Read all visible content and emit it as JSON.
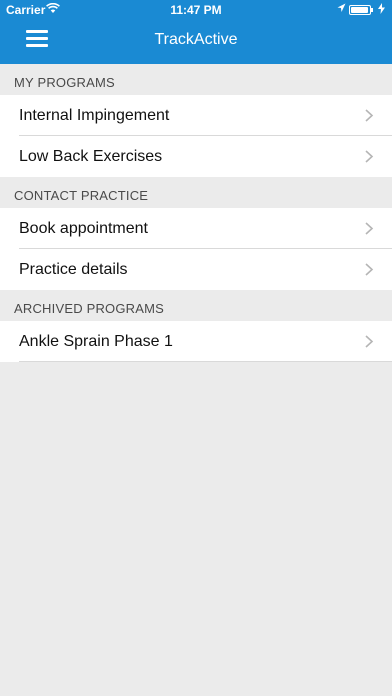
{
  "status_bar": {
    "carrier": "Carrier",
    "time": "11:47 PM"
  },
  "nav": {
    "title": "TrackActive",
    "menu_icon": "hamburger-menu-icon"
  },
  "sections": [
    {
      "header": "MY PROGRAMS",
      "items": [
        {
          "label": "Internal Impingement"
        },
        {
          "label": "Low Back Exercises"
        }
      ]
    },
    {
      "header": "CONTACT PRACTICE",
      "items": [
        {
          "label": "Book appointment"
        },
        {
          "label": "Practice details"
        }
      ]
    },
    {
      "header": "ARCHIVED PROGRAMS",
      "items": [
        {
          "label": "Ankle Sprain Phase 1"
        }
      ]
    }
  ],
  "colors": {
    "header_bg": "#1a8ad3",
    "page_bg": "#ebebeb"
  }
}
